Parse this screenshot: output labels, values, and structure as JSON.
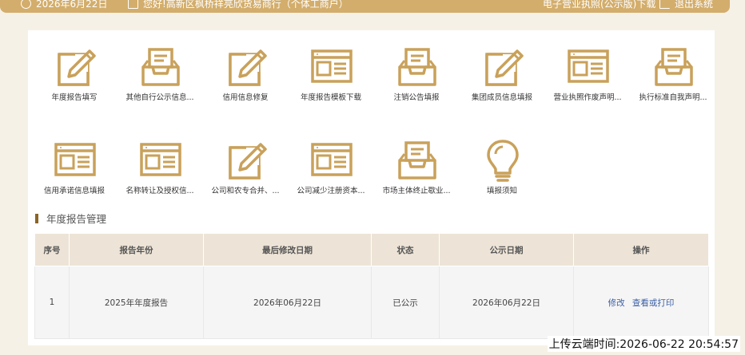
{
  "header": {
    "date": "2026年6月22日",
    "company": "您好!高新区枫桥祥亮欣货易商行（个体工商户）",
    "license_download": "电子营业执照(公示版)下载",
    "logout": "退出系统"
  },
  "tiles": [
    {
      "label": "年度报告填写",
      "icon": "edit-pencil-icon"
    },
    {
      "label": "其他自行公示信息...",
      "icon": "inbox-tray-icon"
    },
    {
      "label": "信用信息修复",
      "icon": "edit-pencil-icon"
    },
    {
      "label": "年度报告模板下载",
      "icon": "browser-window-icon"
    },
    {
      "label": "注销公告填报",
      "icon": "inbox-tray-icon"
    },
    {
      "label": "集团成员信息填报",
      "icon": "edit-pencil-icon"
    },
    {
      "label": "营业执照作废声明...",
      "icon": "browser-window-icon"
    },
    {
      "label": "执行标准自我声明...",
      "icon": "inbox-tray-icon"
    },
    {
      "label": "信用承诺信息填报",
      "icon": "browser-window-icon"
    },
    {
      "label": "名称转让及授权信...",
      "icon": "browser-window-icon"
    },
    {
      "label": "公司和农专合并、...",
      "icon": "edit-pencil-icon"
    },
    {
      "label": "公司减少注册资本...",
      "icon": "browser-window-icon"
    },
    {
      "label": "市场主体终止歇业...",
      "icon": "inbox-tray-icon"
    },
    {
      "label": "填报须知",
      "icon": "lightbulb-icon"
    }
  ],
  "section": {
    "title": "年度报告管理"
  },
  "table": {
    "headers": [
      "序号",
      "报告年份",
      "最后修改日期",
      "状态",
      "公示日期",
      "操作"
    ],
    "rows": [
      {
        "index": "1",
        "year": "2025年年度报告",
        "modified": "2026年06月22日",
        "status": "已公示",
        "published": "2026年06月22日",
        "edit": "修改",
        "view_print": "查看或打印"
      }
    ]
  },
  "upload_time": "上传云端时间:2026-06-22 20:54:57",
  "colors": {
    "accent": "#d3ad6b",
    "icon": "#c9a15a",
    "header_row": "#ede4d7",
    "link": "#3a5ea6"
  }
}
